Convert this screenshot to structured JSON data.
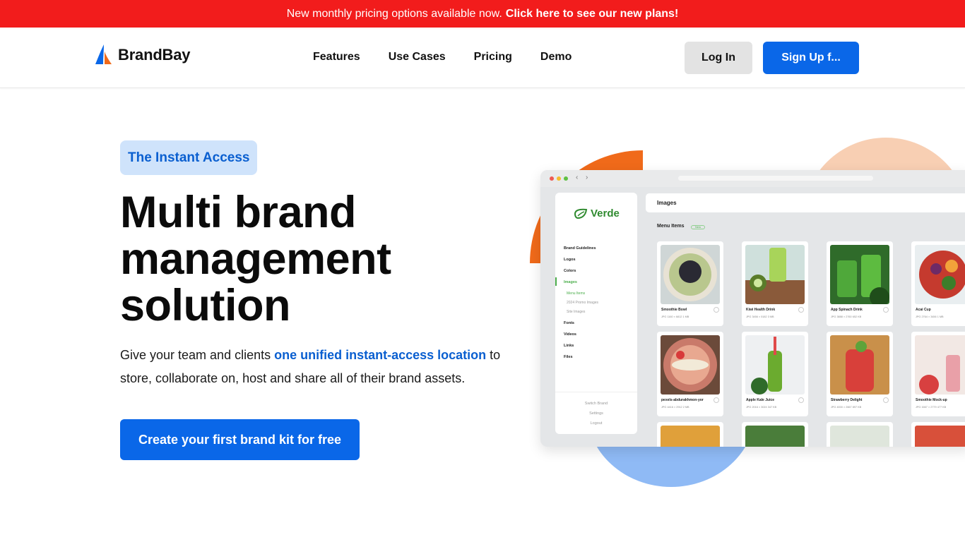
{
  "announcement": {
    "text": "New monthly pricing options available now.",
    "link": "Click here to see our new plans!"
  },
  "brand": {
    "name": "BrandBay"
  },
  "nav": {
    "items": [
      "Features",
      "Use Cases",
      "Pricing",
      "Demo"
    ],
    "login": "Log In",
    "signup": "Sign Up f..."
  },
  "hero": {
    "badge": "The Instant Access",
    "title_lines": [
      "Multi brand",
      "management",
      "solution"
    ],
    "sub_before": "Give your team and clients ",
    "sub_highlight": "one unified instant-access location",
    "sub_after": " to store, collaborate on, host and share all of their brand assets.",
    "cta": "Create your first brand kit for free"
  },
  "mockup": {
    "brand": "Verde",
    "sidebar": {
      "items": [
        "Brand Guidelines",
        "Logos",
        "Colors",
        "Images"
      ],
      "sub_items": [
        "Menu Items",
        "2024 Promo Images",
        "Site Images"
      ],
      "items_after": [
        "Fonts",
        "Videos",
        "Links",
        "Files"
      ],
      "footer": [
        "Switch Brand",
        "Settings",
        "Logout"
      ]
    },
    "header_title": "Images",
    "section_title": "Menu Items",
    "new_label": "New",
    "cards": [
      {
        "name": "Smoothie Bowl",
        "meta": "JPG  1160 × 6812  1 MB"
      },
      {
        "name": "Kiwi Health Drink",
        "meta": "JPG  3456 × 5182  3 MB"
      },
      {
        "name": "App Spinach Drink",
        "meta": "JPG  3888 × 2760  652 KB"
      },
      {
        "name": "Acai Cup",
        "meta": "JPG  2764 × 3456  1 MB"
      },
      {
        "name": "pexels-abdurakhmon-yor",
        "meta": "JPG  4416 × 2912  2 MB"
      },
      {
        "name": "Apple Kale Juice",
        "meta": "JPG  2016 × 3024  347 KB"
      },
      {
        "name": "Strawberry Delight",
        "meta": "JPG  4000 × 2667  897 KB"
      },
      {
        "name": "Smoothie Mock-up",
        "meta": "JPG  1667 × 2779  477 KB"
      }
    ]
  },
  "colors": {
    "accent": "#0a67e8",
    "announce": "#f21c1c",
    "badge_bg": "#cfe3fb",
    "verde_green": "#2f8a2f"
  }
}
